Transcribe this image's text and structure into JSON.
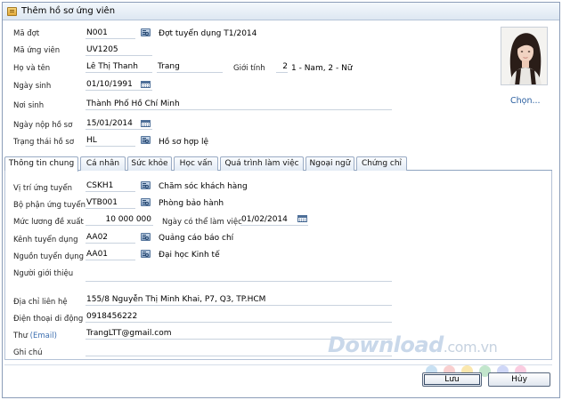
{
  "window": {
    "title": "Thêm hồ sơ ứng viên"
  },
  "header_form": {
    "ma_dot": {
      "label": "Mã đợt",
      "value": "N001",
      "desc": "Đợt tuyển dụng T1/2014"
    },
    "ma_ung_vien": {
      "label": "Mã ứng viên",
      "value": "UV1205"
    },
    "ho_ten": {
      "label": "Họ và tên",
      "first": "Lê Thị Thanh",
      "last": "Trang"
    },
    "gioi_tinh": {
      "label": "Giới tính",
      "value": "2",
      "hint": "1 - Nam, 2 - Nữ"
    },
    "ngay_sinh": {
      "label": "Ngày sinh",
      "value": "01/10/1991"
    },
    "noi_sinh": {
      "label": "Nơi sinh",
      "value": "Thành Phố Hồ Chí Minh"
    },
    "ngay_nop": {
      "label": "Ngày nộp hồ sơ",
      "value": "15/01/2014"
    },
    "trang_thai": {
      "label": "Trạng thái hồ sơ",
      "value": "HL",
      "desc": "Hồ sơ hợp lệ"
    }
  },
  "photo": {
    "choose_label": "Chọn..."
  },
  "tabs": [
    {
      "label": "Thông tin chung"
    },
    {
      "label": "Cá nhân"
    },
    {
      "label": "Sức khỏe"
    },
    {
      "label": "Học vấn"
    },
    {
      "label": "Quá trình làm việc"
    },
    {
      "label": "Ngoại ngữ"
    },
    {
      "label": "Chứng chỉ"
    }
  ],
  "general": {
    "vi_tri": {
      "label": "Vị trí ứng tuyển",
      "value": "CSKH1",
      "desc": "Chăm sóc khách hàng"
    },
    "bo_phan": {
      "label": "Bộ phận ứng tuyển",
      "value": "VTB001",
      "desc": "Phòng bảo hành"
    },
    "muc_luong": {
      "label": "Mức lương đề xuất",
      "value": "10 000 000"
    },
    "ngay_lam": {
      "label": "Ngày có thể làm việc",
      "value": "01/02/2014"
    },
    "kenh": {
      "label": "Kênh tuyển dụng",
      "value": "AA02",
      "desc": "Quảng cáo báo chí"
    },
    "nguon": {
      "label": "Nguồn tuyển dụng",
      "value": "AA01",
      "desc": "Đại học Kinh tế"
    },
    "gioi_thieu": {
      "label": "Người giới thiệu",
      "value": ""
    },
    "dia_chi": {
      "label": "Địa chỉ liên hệ",
      "value": "155/8 Nguyễn Thị Minh Khai, P7, Q3, TP.HCM"
    },
    "dien_thoai": {
      "label": "Điện thoại di động",
      "value": "0918456222"
    },
    "thu": {
      "label": "Thư",
      "label_suffix": "(Email)",
      "value": "TrangLTT@gmail.com"
    },
    "ghi_chu": {
      "label": "Ghi chú",
      "value": ""
    }
  },
  "watermark": {
    "text": "Download",
    "suffix": ".com.vn"
  },
  "watermark_dot_colors": [
    "#9ac7e8",
    "#f3a8a8",
    "#f5d36b",
    "#8fd1a3",
    "#a8b7f0",
    "#f5a3c7"
  ],
  "buttons": {
    "save": "Lưu",
    "cancel": "Hủy"
  }
}
